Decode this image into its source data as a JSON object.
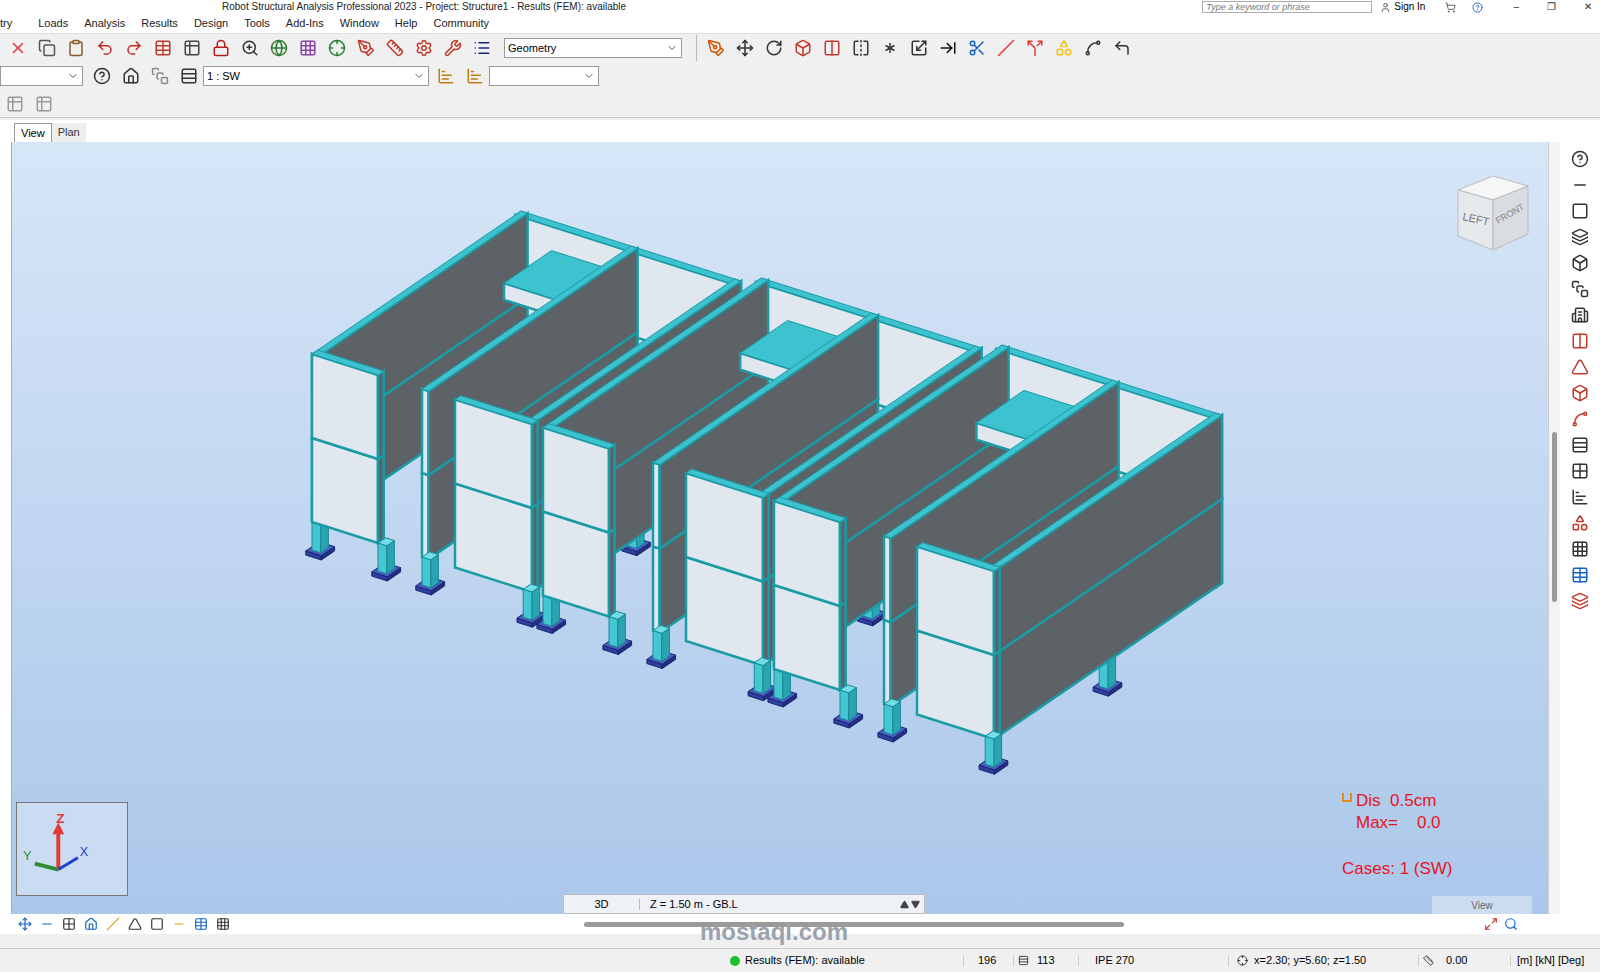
{
  "window": {
    "title": "Robot Structural Analysis Professional 2023 - Project: Structure1 - Results (FEM): available",
    "controls": [
      "–",
      "❐",
      "✕"
    ]
  },
  "title_bar": {
    "search_placeholder": "Type a keyword or phrase",
    "sign_in": "Sign In"
  },
  "menu": [
    "try",
    "Loads",
    "Analysis",
    "Results",
    "Design",
    "Tools",
    "Add-Ins",
    "Window",
    "Help",
    "Community"
  ],
  "toolbar": {
    "display_mode": "Geometry",
    "case_select": "1 : SW"
  },
  "tabs": [
    {
      "label": "View",
      "selected": true
    },
    {
      "label": "Plan",
      "selected": false
    }
  ],
  "view_cube": {
    "faces": [
      "LEFT",
      "FRONT"
    ]
  },
  "axes": [
    "Z",
    "Y",
    "X"
  ],
  "legend": {
    "dis": "Dis  0.5cm",
    "max": "Max=    0.0",
    "cases": "Cases: 1 (SW)"
  },
  "view_bar": {
    "mode": "3D",
    "level": "Z = 1.50 m - GB.L",
    "label": "View"
  },
  "watermark": "mostaql.com",
  "status_bar": {
    "results": "Results (FEM): available",
    "nodes": "196",
    "bars": "113",
    "section": "IPE 270",
    "coords": "x=2.30; y=5.60; z=1.50",
    "angle": "0.00",
    "units": "[m] [kN] [Deg]"
  }
}
